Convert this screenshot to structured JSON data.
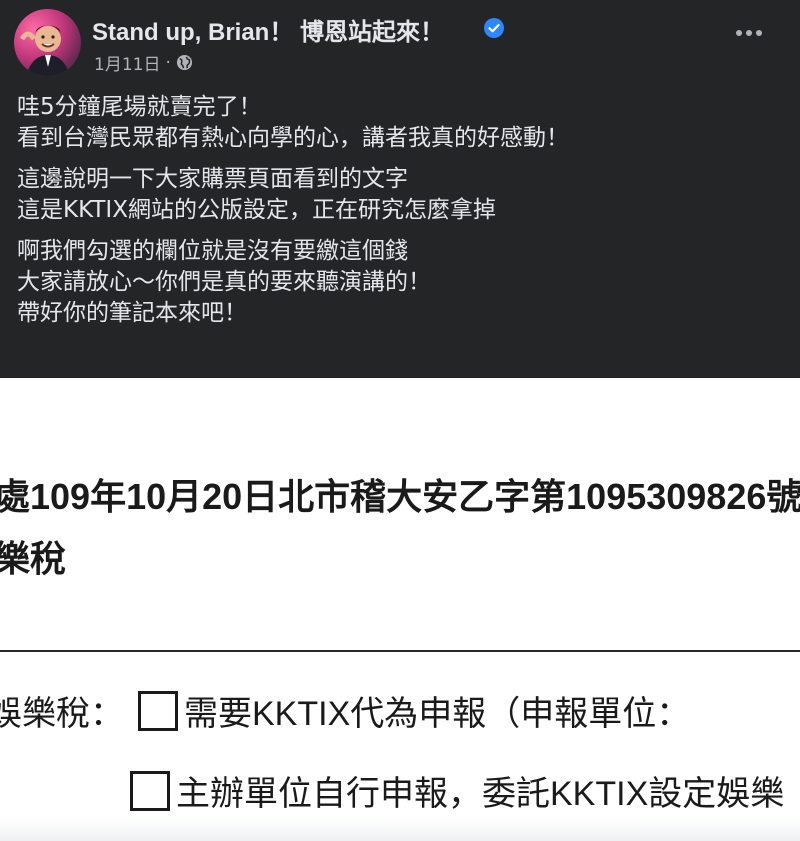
{
  "post": {
    "page_name": "Stand up, Brian！ 博恩站起來！",
    "date": "1月11日",
    "meta_separator": "·",
    "paragraphs": [
      [
        "哇5分鐘尾場就賣完了！",
        "看到台灣民眾都有熱心向學的心，講者我真的好感動！"
      ],
      [
        "這邊說明一下大家購票頁面看到的文字",
        "這是KKTIX網站的公版設定，正在研究怎麼拿掉"
      ],
      [
        "啊我們勾選的欄位就是沒有要繳這個錢",
        "大家請放心～你們是真的要來聽演講的！",
        "帶好你的筆記本來吧！"
      ]
    ],
    "colors": {
      "background": "#242526",
      "text": "#e4e6eb",
      "secondary": "#b0b3b8",
      "verified": "#2d88ff"
    },
    "icons": [
      "verified-badge-icon",
      "globe-icon",
      "more-options-icon"
    ]
  },
  "document": {
    "line1": "處109年10月20日北市稽大安乙字第1095309826號",
    "line2": "樂稅",
    "tax_label": "娛樂稅：",
    "option1": "需要KKTIX代為申報（申報單位：",
    "option2": "主辦單位自行申報，委託KKTIX設定娛樂"
  }
}
